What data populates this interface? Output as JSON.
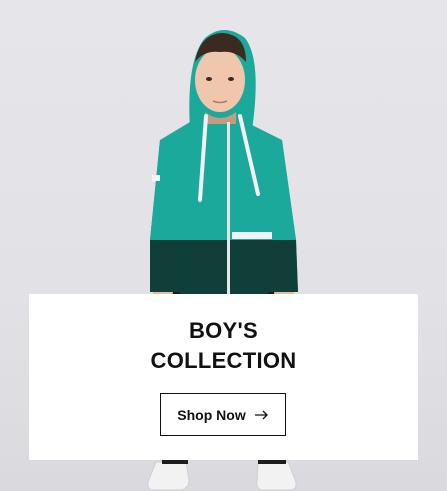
{
  "banner": {
    "title_line1": "BOY'S",
    "title_line2": "COLLECTION",
    "cta_label": "Shop Now",
    "cta_icon": "arrow-right-icon"
  },
  "colors": {
    "background": "#e4e4e8",
    "hoodie_teal": "#1aa99a",
    "hoodie_dark": "#0f3f38",
    "card": "#ffffff",
    "text": "#111111"
  }
}
